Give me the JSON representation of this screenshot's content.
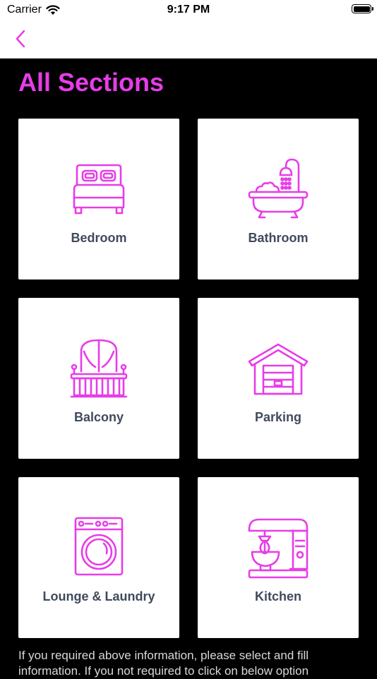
{
  "status_bar": {
    "carrier": "Carrier",
    "time": "9:17 PM"
  },
  "nav": {
    "back_icon": "chevron-left-icon"
  },
  "colors": {
    "accent": "#e83ce8",
    "card_label": "#3f4a5c",
    "background": "#000000"
  },
  "page": {
    "title": "All Sections"
  },
  "sections": [
    {
      "label": "Bedroom",
      "icon": "bed-icon"
    },
    {
      "label": "Bathroom",
      "icon": "bathtub-icon"
    },
    {
      "label": "Balcony",
      "icon": "balcony-icon"
    },
    {
      "label": "Parking",
      "icon": "garage-icon"
    },
    {
      "label": "Lounge & Laundry",
      "icon": "washing-machine-icon"
    },
    {
      "label": "Kitchen",
      "icon": "stand-mixer-icon"
    }
  ],
  "footer": {
    "text": "If you required above information, please select and fill information. If you not required to click on below option"
  }
}
